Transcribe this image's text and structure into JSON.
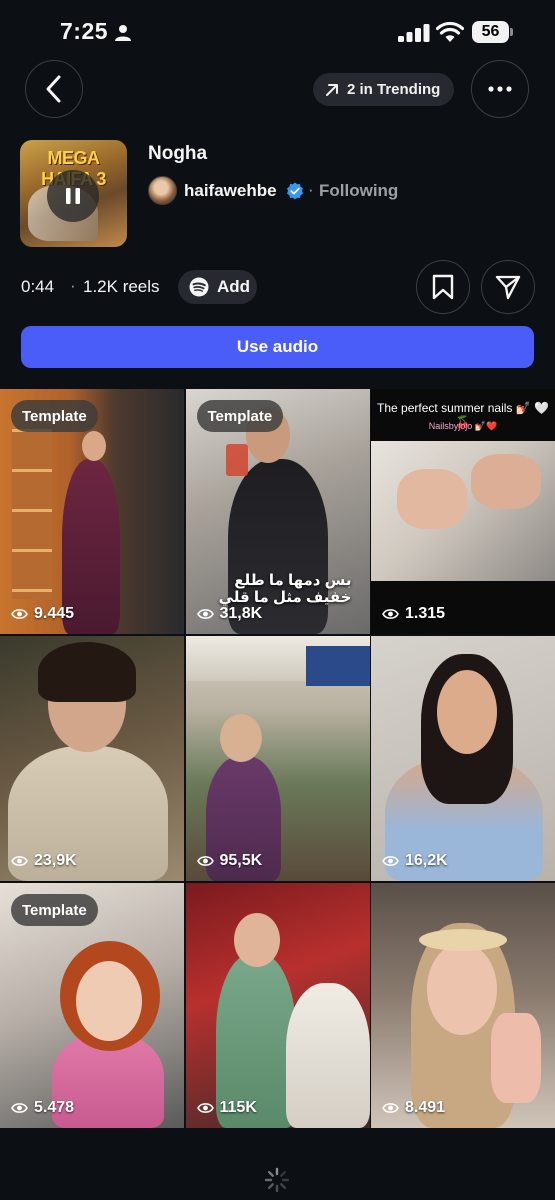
{
  "status_bar": {
    "time": "7:25",
    "battery": "56"
  },
  "nav": {
    "trending_label": "2 in Trending"
  },
  "audio": {
    "album_text": "MEGA HAIFA 3",
    "title": "Nogha",
    "artist": "haifawehbe",
    "follow_status": "Following",
    "duration": "0:44",
    "reels_count": "1.2K reels",
    "add_label": "Add",
    "use_audio_label": "Use audio"
  },
  "reels": [
    {
      "template": "Template",
      "views": "9.445"
    },
    {
      "template": "Template",
      "views": "31,8K",
      "overlay": "بس دمها ما طلع خفيف مثل ما قلي"
    },
    {
      "views": "1.315",
      "caption": "The perfect summer nails 💅🏻 🤍🍒",
      "caption_sub": "Nailsbyjojo 💅🏻❤️"
    },
    {
      "views": "23,9K"
    },
    {
      "views": "95,5K"
    },
    {
      "views": "16,2K"
    },
    {
      "template": "Template",
      "views": "5.478"
    },
    {
      "views": "115K"
    },
    {
      "views": "8.491"
    }
  ],
  "colors": {
    "accent": "#4a5df9",
    "background": "#0c1014",
    "verified": "#3897f0"
  }
}
